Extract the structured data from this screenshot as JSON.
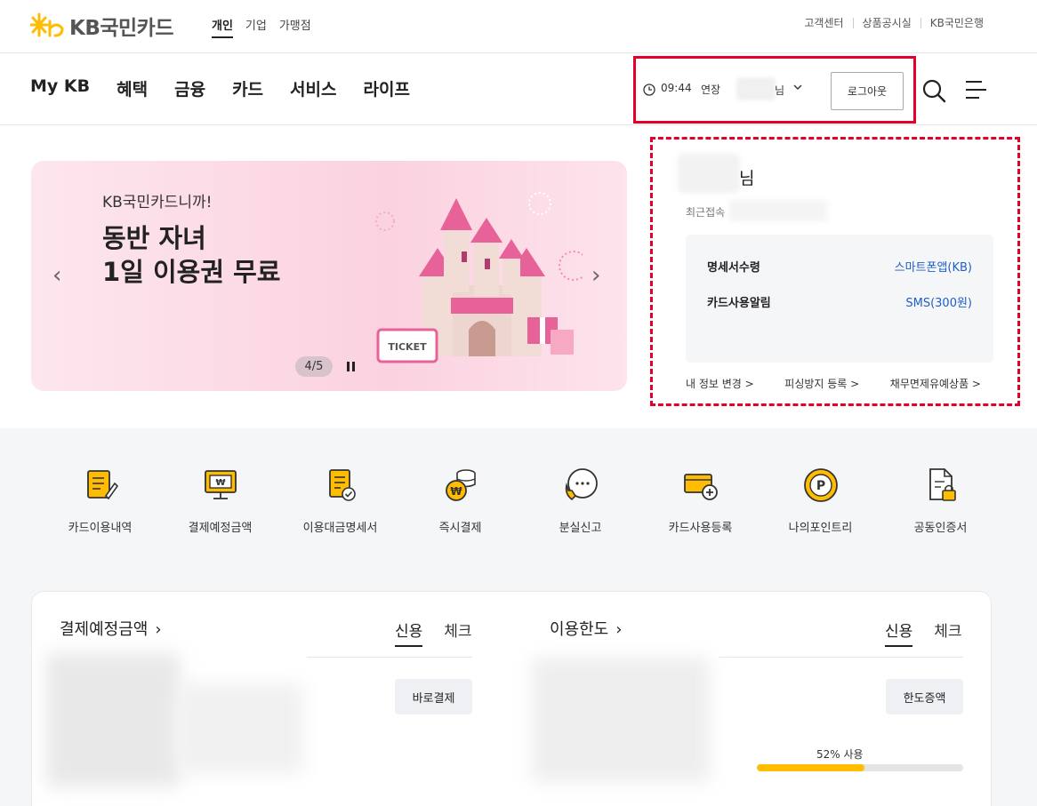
{
  "header": {
    "logo_text": "KB국민카드",
    "segments": [
      "개인",
      "기업",
      "가맹점"
    ],
    "util_links": [
      "고객센터",
      "상품공시실",
      "KB국민은행"
    ]
  },
  "gnb": {
    "menu": [
      "My KB",
      "혜택",
      "금융",
      "카드",
      "서비스",
      "라이프"
    ],
    "session": {
      "time": "09:44",
      "extend_label": "연장",
      "name_suffix": "님",
      "logout_label": "로그아웃"
    },
    "icons": [
      "search-icon",
      "hamburger-menu-icon"
    ]
  },
  "banner": {
    "kicker": "KB국민카드니까!",
    "title": "동반 자녀\n1일 이용권 무료",
    "ticket_text": "TICKET",
    "pager": "4/5"
  },
  "user_panel": {
    "name_suffix": "님",
    "recent_label": "최근접속",
    "rows": [
      {
        "label": "명세서수령",
        "value": "스마트폰앱(KB)"
      },
      {
        "label": "카드사용알림",
        "value": "SMS(300원)"
      }
    ],
    "links": [
      "내 정보 변경 >",
      "피싱방지 등록 >",
      "채무면제유예상품 >"
    ]
  },
  "quick_menu": [
    {
      "label": "카드이용내역",
      "icon": "card-usage-icon"
    },
    {
      "label": "결제예정금액",
      "icon": "payment-due-icon"
    },
    {
      "label": "이용대금명세서",
      "icon": "statement-icon"
    },
    {
      "label": "즉시결제",
      "icon": "instant-pay-icon"
    },
    {
      "label": "분실신고",
      "icon": "lost-report-icon"
    },
    {
      "label": "카드사용등록",
      "icon": "card-register-icon"
    },
    {
      "label": "나의포인트리",
      "icon": "point-icon"
    },
    {
      "label": "공동인증서",
      "icon": "certificate-icon"
    }
  ],
  "payment": {
    "title": "결제예정금액",
    "tabs": [
      "신용",
      "체크"
    ],
    "button": "바로결제"
  },
  "limit": {
    "title": "이용한도",
    "tabs": [
      "신용",
      "체크"
    ],
    "button": "한도증액",
    "usage_label": "52% 사용",
    "usage_ratio": 0.52
  },
  "colors": {
    "kb_yellow": "#ffbc00",
    "highlight_red": "#e4002b",
    "link_blue": "#1f5ec9"
  }
}
